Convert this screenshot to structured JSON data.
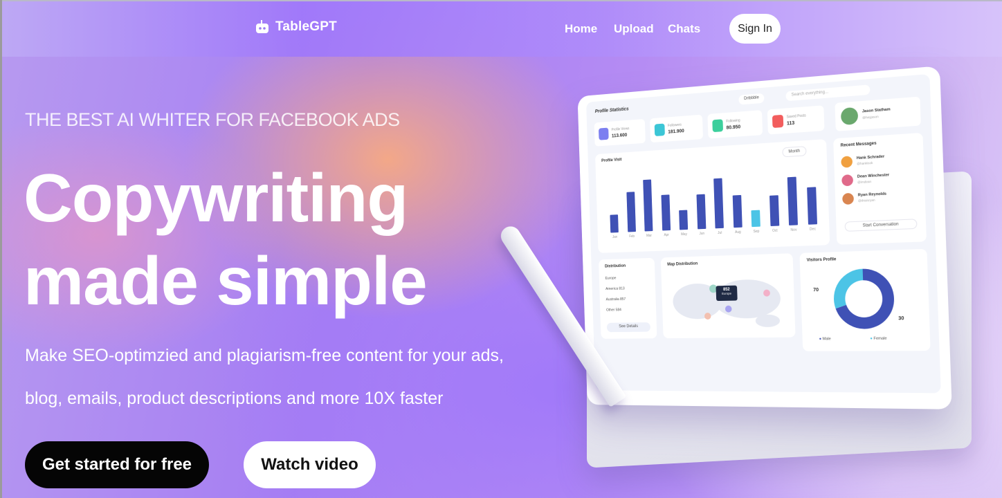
{
  "header": {
    "logo_text": "TableGPT",
    "nav": [
      "Home",
      "Upload",
      "Chats"
    ],
    "signin_label": "Sign In"
  },
  "hero": {
    "eyebrow": "THE BEST AI WHITER FOR FACEBOOK ADS",
    "headline_line1": "Copywriting",
    "headline_line2": "made simple",
    "sub_line1": "Make SEO-optimzied and plagiarism-free content for your ads,",
    "sub_line2": "blog, emails, product descriptions and more 10X faster",
    "cta_primary": "Get started for free",
    "cta_secondary": "Watch video"
  },
  "dashboard": {
    "title": "Profile Statistics",
    "dropdown": "Dribbble",
    "search_placeholder": "Search everything...",
    "stats": [
      {
        "label": "Profile Views",
        "value": "113.600",
        "color": "#7c7ff0"
      },
      {
        "label": "Followers",
        "value": "181.900",
        "color": "#3cc6d6"
      },
      {
        "label": "Following",
        "value": "80.950",
        "color": "#3ccf9c"
      },
      {
        "label": "Saved Posts",
        "value": "113",
        "color": "#f25d5d"
      }
    ],
    "profile": {
      "name": "Jason Statham",
      "handle": "@heyjason"
    },
    "visit_chart": {
      "title": "Profile Visit",
      "filter": "Month",
      "months": [
        "Jan",
        "Feb",
        "Mar",
        "Apr",
        "May",
        "Jun",
        "Jul",
        "Aug",
        "Sep",
        "Oct",
        "Nov",
        "Dec"
      ],
      "values": [
        20,
        45,
        58,
        40,
        22,
        38,
        55,
        35,
        18,
        33,
        52,
        40
      ]
    },
    "messages": {
      "title": "Recent Messages",
      "items": [
        {
          "name": "Hank Schrader",
          "handle": "@hankisok"
        },
        {
          "name": "Dean Winchester",
          "handle": "@imdean"
        },
        {
          "name": "Ryan Reynolds",
          "handle": "@thisisryan"
        }
      ],
      "button": "Start Conversation"
    },
    "distribution": {
      "title": "Distribution",
      "rows": [
        {
          "label": "Europe",
          "value": ""
        },
        {
          "label": "America",
          "value": "813"
        },
        {
          "label": "Australia",
          "value": "857"
        },
        {
          "label": "Other",
          "value": "584"
        }
      ],
      "button": "See Details"
    },
    "map": {
      "title": "Map Distribution",
      "tooltip_value": "852",
      "tooltip_label": "Europe"
    },
    "visitors": {
      "title": "Visitors Profile",
      "slices": [
        {
          "label": "Male",
          "pct": 70
        },
        {
          "label": "Female",
          "pct": 30
        }
      ],
      "pct_male": "70",
      "pct_female": "30"
    }
  },
  "colors": {
    "primary_btn": "#050505",
    "chart_bar": "#3f51b5",
    "accent_teal": "#4cc4e6"
  }
}
